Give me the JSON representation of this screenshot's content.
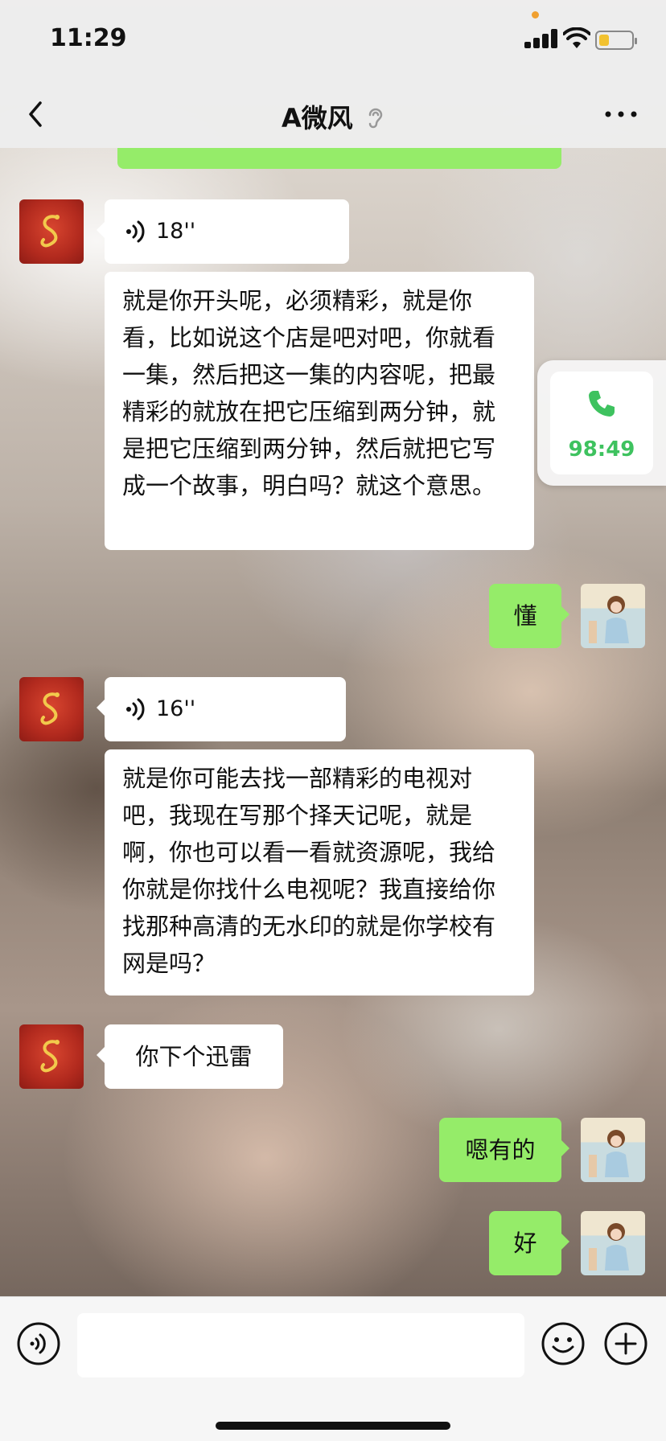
{
  "status_bar": {
    "time": "11:29"
  },
  "header": {
    "title": "A微风"
  },
  "call_widget": {
    "duration": "98:49"
  },
  "messages": [
    {
      "side": "out",
      "kind": "text",
      "text": ""
    },
    {
      "side": "in",
      "kind": "voice",
      "duration": "18''"
    },
    {
      "side": "in",
      "kind": "text",
      "text": "就是你开头呢，必须精彩，就是你看，比如说这个店是吧对吧，你就看一集，然后把这一集的内容呢，把最精彩的就放在把它压缩到两分钟，就是把它压缩到两分钟，然后就把它写成一个故事，明白吗？就这个意思。"
    },
    {
      "side": "out",
      "kind": "text",
      "text": "懂"
    },
    {
      "side": "in",
      "kind": "voice",
      "duration": "16''"
    },
    {
      "side": "in",
      "kind": "text",
      "text": "就是你可能去找一部精彩的电视对吧，我现在写那个择天记呢，就是啊，你也可以看一看就资源呢，我给你就是你找什么电视呢？我直接给你找那种高清的无水印的就是你学校有网是吗？"
    },
    {
      "side": "in",
      "kind": "text",
      "text": "你下个迅雷"
    },
    {
      "side": "out",
      "kind": "text",
      "text": "嗯有的"
    },
    {
      "side": "out",
      "kind": "text",
      "text": "好"
    }
  ],
  "input_bar": {
    "placeholder": ""
  },
  "colors": {
    "bubble_out": "#95ec69",
    "bubble_in": "#ffffff",
    "call_accent": "#3ec25f",
    "battery": "#f2c230"
  },
  "icons": {
    "back": "chevron-left-icon",
    "ear": "ear-icon",
    "more": "more-dots-icon",
    "voice_message": "voice-wave-icon",
    "phone": "phone-icon",
    "voice_input": "voice-input-icon",
    "emoji": "emoji-icon",
    "plus": "plus-icon"
  }
}
